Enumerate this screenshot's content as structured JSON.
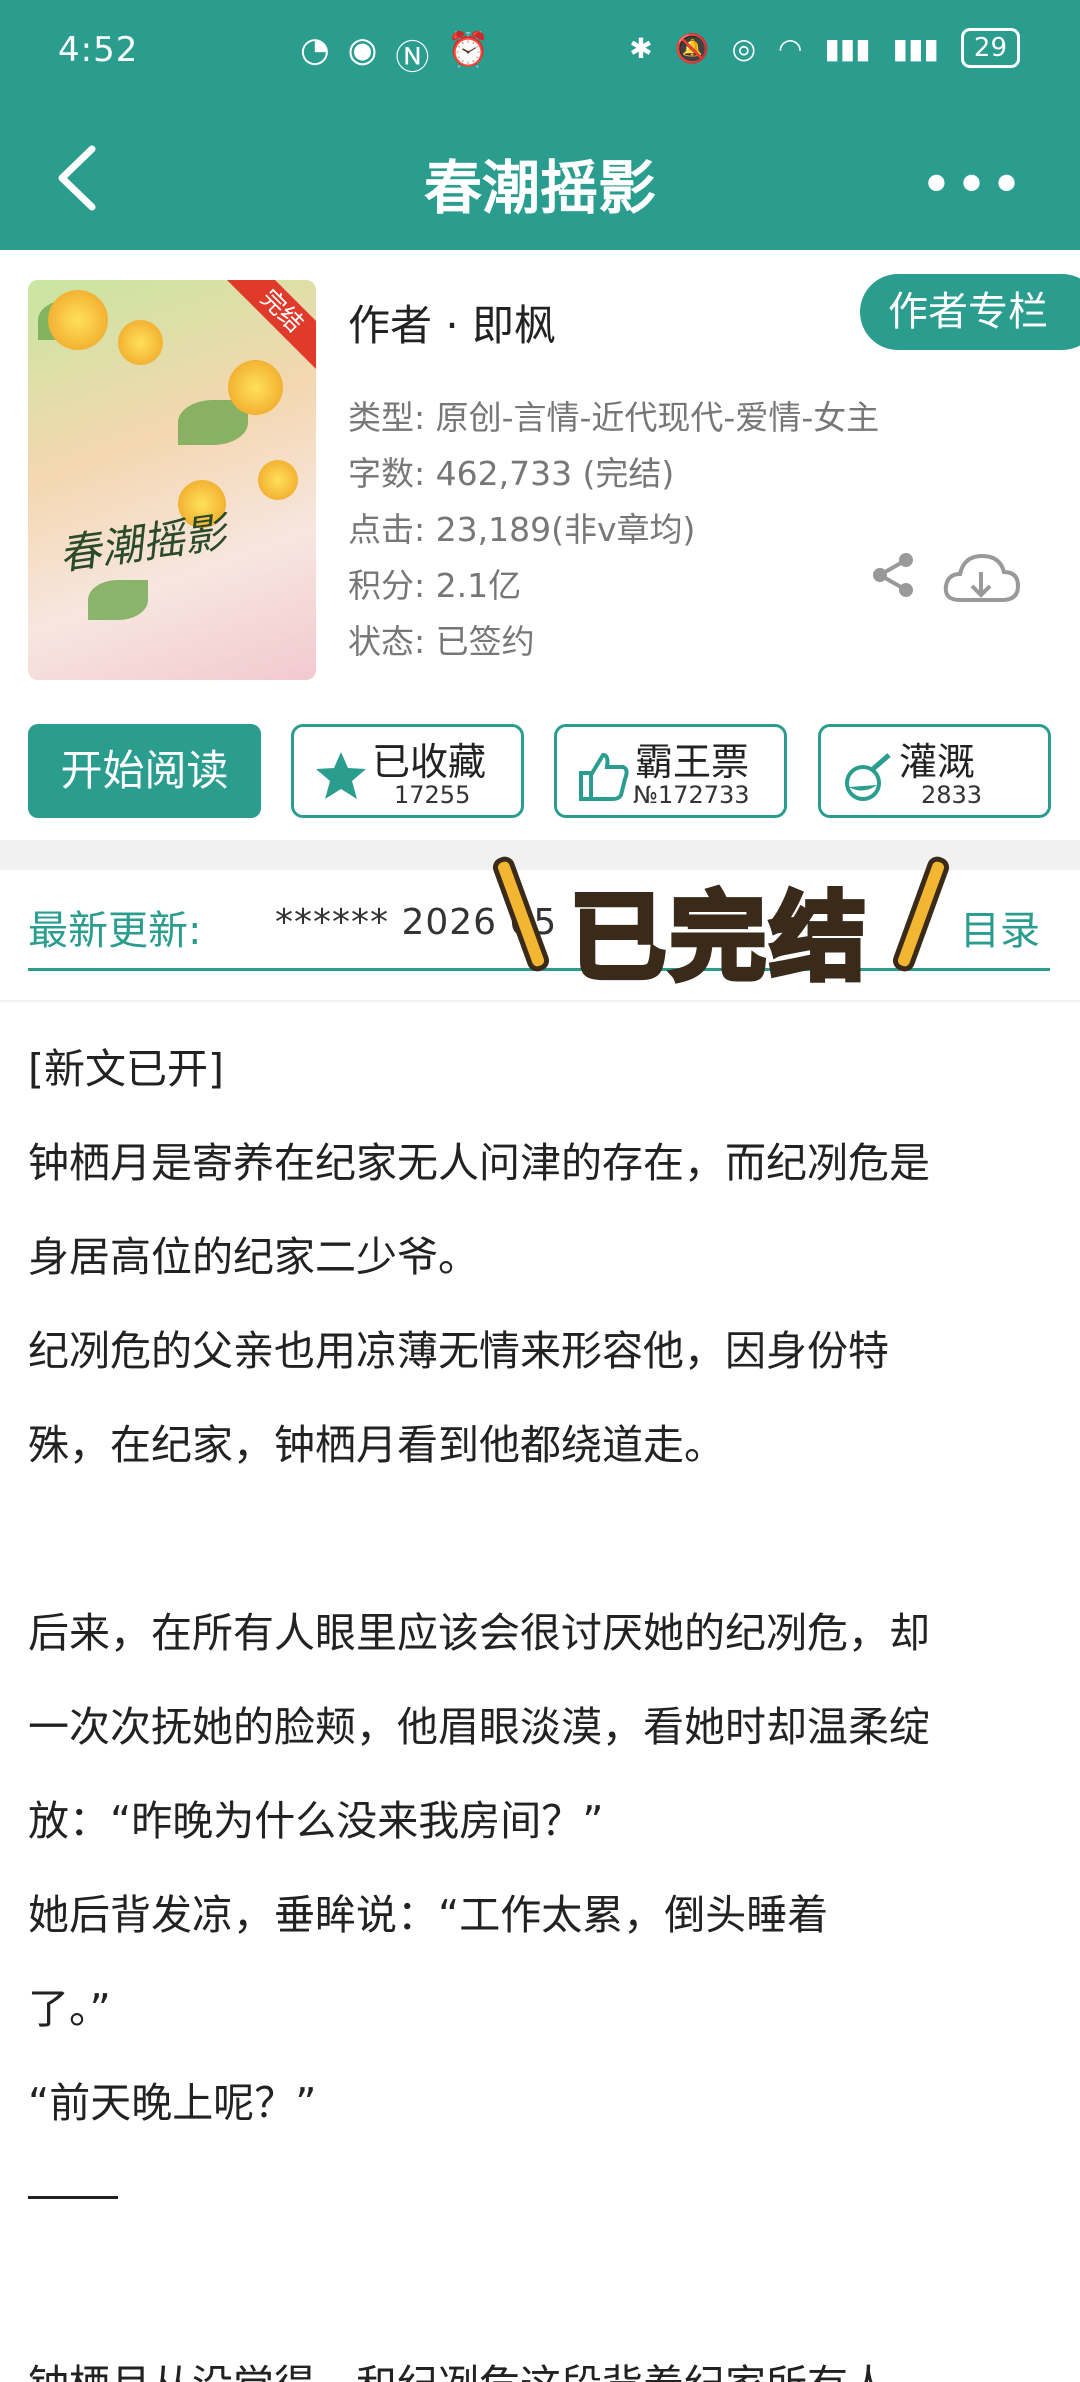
{
  "status_bar": {
    "time": "4:52",
    "battery": "29"
  },
  "header": {
    "title": "春潮摇影"
  },
  "book": {
    "cover_title": "春潮摇影",
    "cover_badge": "完结",
    "author_label": "作者 · 即枫",
    "author_column_button": "作者专栏",
    "meta": [
      "类型: 原创-言情-近代现代-爱情-女主",
      "字数: 462,733 (完结)",
      "点击: 23,189(非v章均)",
      "积分: 2.1亿",
      "状态: 已签约"
    ]
  },
  "actions": {
    "read": "开始阅读",
    "collect": {
      "label": "已收藏",
      "count": "17255"
    },
    "vote": {
      "label": "霸王票",
      "count": "№172733"
    },
    "water": {
      "label": "灌溉",
      "count": "2833"
    }
  },
  "update": {
    "label": "最新更新:",
    "text": "****** 2026 05",
    "toc": "目录",
    "overlay": "已完结"
  },
  "description": [
    "[新文已开]",
    "钟栖月是寄养在纪家无人问津的存在，而纪冽危是",
    "身居高位的纪家二少爷。",
    "纪冽危的父亲也用凉薄无情来形容他，因身份特",
    "殊，在纪家，钟栖月看到他都绕道走。",
    "",
    "后来，在所有人眼里应该会很讨厌她的纪冽危，却",
    "一次次抚她的脸颊，他眉眼淡漠，看她时却温柔绽",
    "放：“昨晚为什么没来我房间？”",
    "她后背发凉，垂眸说：“工作太累，倒头睡着",
    "了。”",
    "“前天晚上呢？”"
  ],
  "description_cut": "钟栖月从没觉得，和纪冽危这段背着纪家所有人",
  "colors": {
    "brand": "#2a9d8f",
    "ribbon": "#e03a2a",
    "overlay_accent": "#f2b632"
  }
}
